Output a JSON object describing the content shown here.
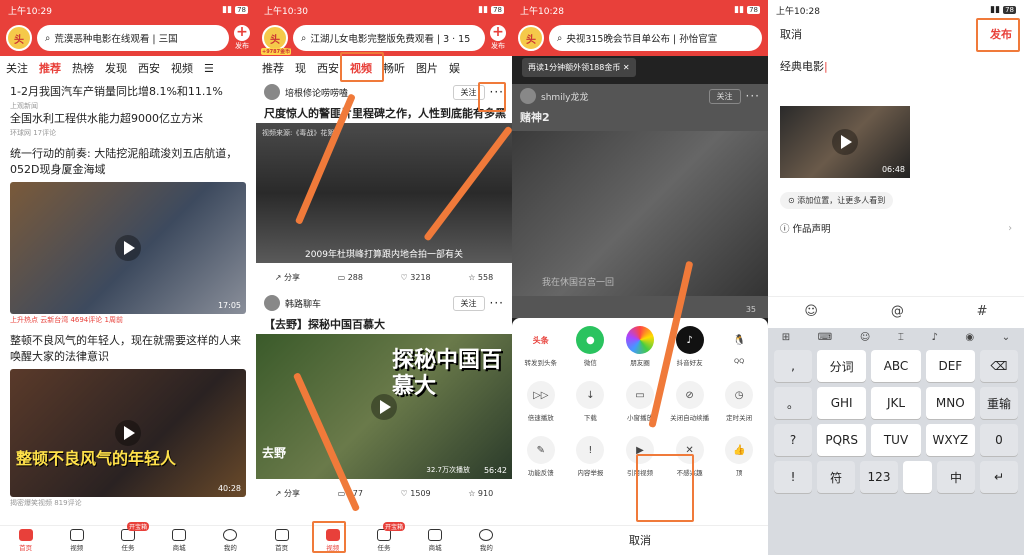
{
  "colors": {
    "brand": "#e8403a",
    "annotation": "#f07a3a"
  },
  "p1": {
    "time": "上午10:29",
    "battery": "78",
    "search": "荒漠恶种电影在线观看 | 三国",
    "publish": "发布",
    "tabs": [
      "关注",
      "推荐",
      "热榜",
      "发现",
      "西安",
      "视频"
    ],
    "news": [
      {
        "title": "1-2月我国汽车产销量同比增8.1%和11.1%",
        "meta": "上观新闻"
      },
      {
        "title": "全国水利工程供水能力超9000亿立方米",
        "meta": "环球网  17评论"
      },
      {
        "title": "统一行动的前奏: 大陆挖泥船疏浚刘五店航道，052D现身厦金海域",
        "meta": "上升热点  云新台湾  4694评论  1周前",
        "duration": "17:05"
      },
      {
        "title": "整顿不良风气的年轻人，现在就需要这样的人来唤醒大家的法律意识",
        "meta": "揭密爆笑视频  819评论",
        "duration": "40:28",
        "overlay": "整顿不良风气的年轻人"
      }
    ],
    "nav": [
      "首页",
      "视频",
      "任务",
      "商城",
      "我的"
    ],
    "nav_tag": "开宝箱"
  },
  "p2": {
    "time": "上午10:30",
    "battery": "78",
    "search": "江湖儿女电影完整版免费观看 | 3 · 15",
    "publish": "发布",
    "coin": "+9787金币",
    "tabs": [
      "推荐",
      "现",
      "西安",
      "视频",
      "畅听",
      "图片",
      "娱"
    ],
    "v1": {
      "author": "培根修论唠唠嗑",
      "follow": "关注",
      "title": "尺度惊人的警匪片里程碑之作，人性到底能有多黑",
      "source": "视频来源:《毒战》花絮",
      "subtitle": "2009年杜琪峰打算跟内地合拍一部有关",
      "share": "分享",
      "c": "288",
      "l": "3218",
      "s": "558"
    },
    "v2": {
      "author": "韩路聊车",
      "follow": "关注",
      "title": "【去野】探秘中国百慕大",
      "overlay": "探秘中国百慕大",
      "sign": "去野",
      "views": "32.7万次播放",
      "duration": "56:42",
      "share": "分享",
      "c": "177",
      "l": "1509",
      "s": "910"
    },
    "nav": [
      "首页",
      "视频",
      "任务",
      "商城",
      "我的"
    ],
    "nav_tag": "开宝箱"
  },
  "p3": {
    "time": "上午10:28",
    "battery": "78",
    "search": "央视315晚会节目单公布 | 孙怡官宣",
    "banner": "再读1分钟额外领188金币",
    "author": "shmily龙龙",
    "follow": "关注",
    "title": "赌神2",
    "subtitle": "我在休国召宫一回",
    "likes": "35",
    "row1": [
      "转发到头条",
      "微信",
      "朋友圈",
      "抖音好友",
      "QQ"
    ],
    "row2": [
      "倍速播放",
      "下载",
      "小窗播放",
      "关闭自动续播",
      "定时关闭"
    ],
    "row3": [
      "功能反馈",
      "内容举报",
      "引用视频",
      "不感兴趣",
      "顶"
    ],
    "cancel": "取消"
  },
  "p4": {
    "time": "上午10:28",
    "battery": "78",
    "cancel": "取消",
    "publish": "发布",
    "text": "经典电影",
    "duration": "06:48",
    "location": "添加位置，让更多人看到",
    "statement": "作品声明",
    "keys": {
      "r1": [
        "分词",
        "ABC",
        "DEF"
      ],
      "r2": [
        "GHI",
        "JKL",
        "MNO"
      ],
      "r3": [
        "PQRS",
        "TUV",
        "WXYZ"
      ],
      "left": [
        ",",
        "。",
        "?",
        "!"
      ],
      "right": [
        "重输",
        "0"
      ],
      "bottom": [
        "符",
        "123",
        "中"
      ]
    }
  }
}
